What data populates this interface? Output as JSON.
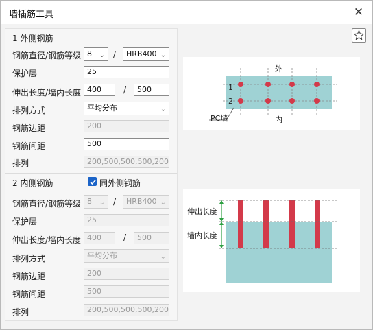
{
  "window": {
    "title": "墙插筋工具",
    "close_glyph": "✕"
  },
  "outer": {
    "header": "1 外侧钢筋",
    "diameter_label": "钢筋直径/钢筋等级",
    "diameter_value": "8",
    "grade_value": "HRB400",
    "cover_label": "保护层",
    "cover_value": "25",
    "length_label": "伸出长度/墙内长度",
    "out_length": "400",
    "in_length": "500",
    "arrange_label": "排列方式",
    "arrange_value": "平均分布",
    "edge_label": "钢筋边距",
    "edge_value": "200",
    "spacing_label": "钢筋间距",
    "spacing_value": "500",
    "layout_label": "排列",
    "layout_value": "200,500,500,500,200"
  },
  "inner": {
    "header": "2 内侧钢筋",
    "same_label": "同外侧钢筋",
    "same_checked": true,
    "diameter_label": "钢筋直径/钢筋等级",
    "diameter_value": "8",
    "grade_value": "HRB400",
    "cover_label": "保护层",
    "cover_value": "25",
    "length_label": "伸出长度/墙内长度",
    "out_length": "400",
    "in_length": "500",
    "arrange_label": "排列方式",
    "arrange_value": "平均分布",
    "edge_label": "钢筋边距",
    "edge_value": "200",
    "spacing_label": "钢筋间距",
    "spacing_value": "500",
    "layout_label": "排列",
    "layout_value": "200,500,500,500,200"
  },
  "slash": "/",
  "plan_diagram": {
    "outside": "外",
    "inside": "内",
    "row1": "1",
    "row2": "2",
    "wall": "PC墙"
  },
  "section_diagram": {
    "extend": "伸出长度",
    "inner": "墙内长度"
  },
  "colors": {
    "wall": "#9fd2d4",
    "rebar": "#d33a4a",
    "accent": "#1c64c8"
  },
  "icons": {
    "close": "close-icon",
    "star": "star-icon",
    "chevron": "chevron-down-icon"
  }
}
